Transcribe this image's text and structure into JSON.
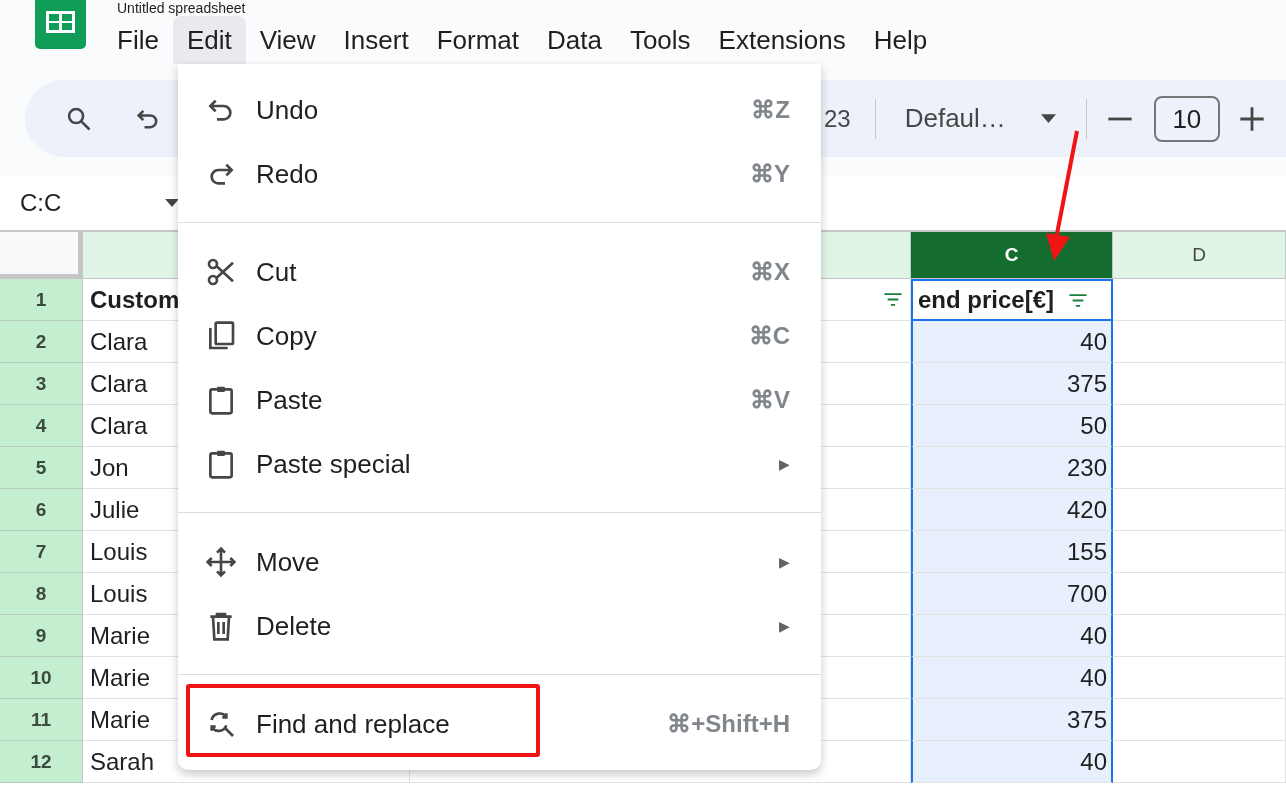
{
  "document": {
    "title": "Untitled spreadsheet"
  },
  "menu_bar": [
    {
      "label": "File",
      "selected": false
    },
    {
      "label": "Edit",
      "selected": true
    },
    {
      "label": "View",
      "selected": false
    },
    {
      "label": "Insert",
      "selected": false
    },
    {
      "label": "Format",
      "selected": false
    },
    {
      "label": "Data",
      "selected": false
    },
    {
      "label": "Tools",
      "selected": false
    },
    {
      "label": "Extensions",
      "selected": false
    },
    {
      "label": "Help",
      "selected": false
    }
  ],
  "toolbar": {
    "number_format": "23",
    "font": "Defaul…",
    "font_size": "10"
  },
  "name_box": "C:C",
  "sheet": {
    "columns": [
      {
        "selected": false,
        "pointed_at": false
      },
      {
        "selected": false,
        "pointed_at": false
      },
      {
        "label": "C",
        "selected": true,
        "pointed_at": true
      },
      {
        "label": "D",
        "selected": false,
        "pointed_at": false
      }
    ],
    "rows": [
      {
        "number": "1",
        "kind": "header",
        "column_a": "Custom",
        "column_c": "end price[€]"
      },
      {
        "number": "2",
        "kind": "data",
        "column_a": "Clara",
        "column_c": "40"
      },
      {
        "number": "3",
        "kind": "data",
        "column_a": "Clara",
        "column_c": "375"
      },
      {
        "number": "4",
        "kind": "data",
        "column_a": "Clara",
        "column_c": "50"
      },
      {
        "number": "5",
        "kind": "data",
        "column_a": "Jon",
        "column_c": "230"
      },
      {
        "number": "6",
        "kind": "data",
        "column_a": "Julie",
        "column_c": "420"
      },
      {
        "number": "7",
        "kind": "data",
        "column_a": "Louis",
        "column_c": "155"
      },
      {
        "number": "8",
        "kind": "data",
        "column_a": "Louis",
        "column_c": "700"
      },
      {
        "number": "9",
        "kind": "data",
        "column_a": "Marie",
        "column_c": "40"
      },
      {
        "number": "10",
        "kind": "data",
        "column_a": "Marie",
        "column_c": "40"
      },
      {
        "number": "11",
        "kind": "data",
        "column_a": "Marie",
        "column_c": "375"
      },
      {
        "number": "12",
        "kind": "data",
        "column_a": "Sarah",
        "column_c": "40"
      }
    ]
  },
  "edit_menu": {
    "groups": [
      [
        {
          "label": "Undo",
          "shortcut": "⌘Z",
          "outlined": false
        },
        {
          "label": "Redo",
          "shortcut": "⌘Y",
          "outlined": false
        }
      ],
      [
        {
          "label": "Cut",
          "shortcut": "⌘X",
          "outlined": false
        },
        {
          "label": "Copy",
          "shortcut": "⌘C",
          "outlined": false
        },
        {
          "label": "Paste",
          "shortcut": "⌘V",
          "outlined": false
        },
        {
          "label": "Paste special",
          "submenu_arrow": "▶",
          "outlined": false
        }
      ],
      [
        {
          "label": "Move",
          "submenu_arrow": "▶",
          "outlined": false
        },
        {
          "label": "Delete",
          "submenu_arrow": "▶",
          "outlined": false
        }
      ],
      [
        {
          "label": "Find and replace",
          "shortcut": "⌘+Shift+H",
          "outlined": true
        }
      ]
    ]
  }
}
